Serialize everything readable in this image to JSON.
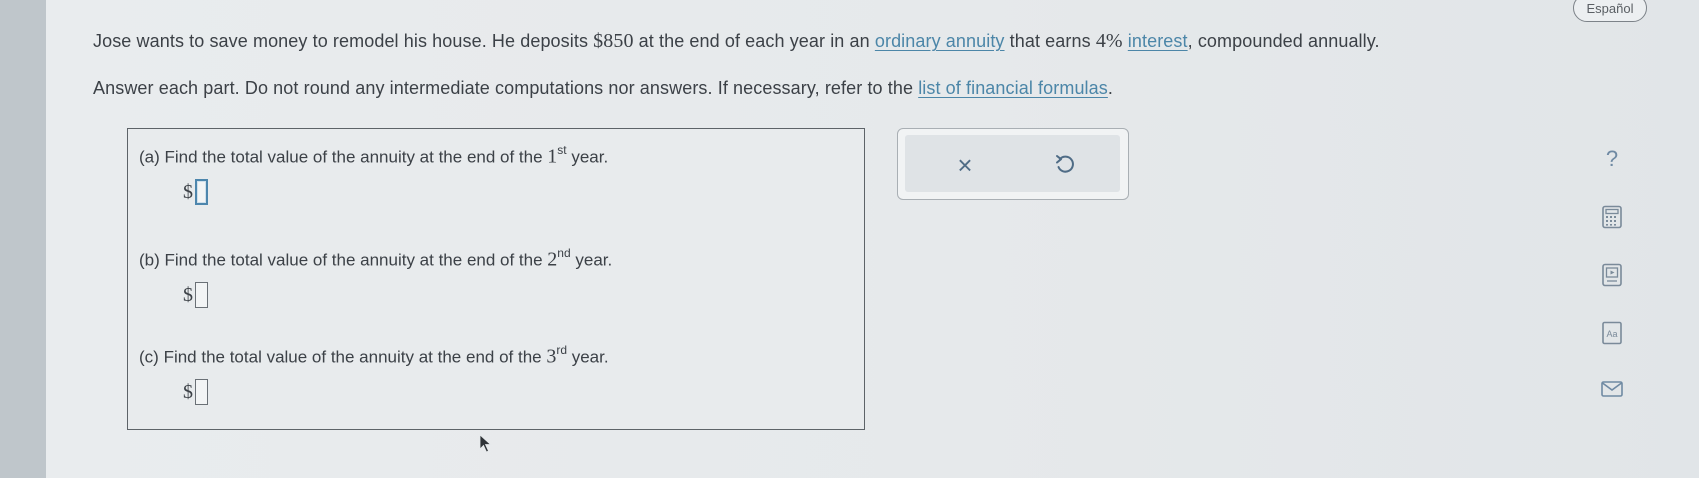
{
  "problem": {
    "l1_a": "Jose wants to save money to remodel his house. He deposits ",
    "deposit": "$850",
    "l1_b": " at the end of each year in an ",
    "link_annuity": "ordinary annuity",
    "l1_c": " that earns ",
    "rate": "4%",
    "l1_d": " ",
    "link_interest": "interest",
    "l1_e": ", compounded annually.",
    "l2_a": "Answer each part. Do not round any intermediate computations nor answers. If necessary, refer to the ",
    "link_formulas": "list of financial formulas",
    "l2_b": "."
  },
  "language_button": "Español",
  "parts": [
    {
      "letter": "(a)",
      "pre": "Find the total value of the annuity at the end of the ",
      "num": "1",
      "suffix": "st",
      "post": " year.",
      "currency": "$",
      "value": ""
    },
    {
      "letter": "(b)",
      "pre": "Find the total value of the annuity at the end of the ",
      "num": "2",
      "suffix": "nd",
      "post": " year.",
      "currency": "$",
      "value": ""
    },
    {
      "letter": "(c)",
      "pre": "Find the total value of the annuity at the end of the ",
      "num": "3",
      "suffix": "rd",
      "post": " year.",
      "currency": "$",
      "value": ""
    }
  ],
  "tools": {
    "clear_glyph": "×",
    "undo_icon": "undo-icon"
  },
  "sidebar": {
    "help_glyph": "?",
    "icons": [
      "help-icon",
      "calculator-icon",
      "video-icon",
      "text-size-icon",
      "mail-icon"
    ]
  },
  "colors": {
    "link": "#4c86a8",
    "active_input": "#4d86ad",
    "tool_icon": "#4f6c86"
  }
}
